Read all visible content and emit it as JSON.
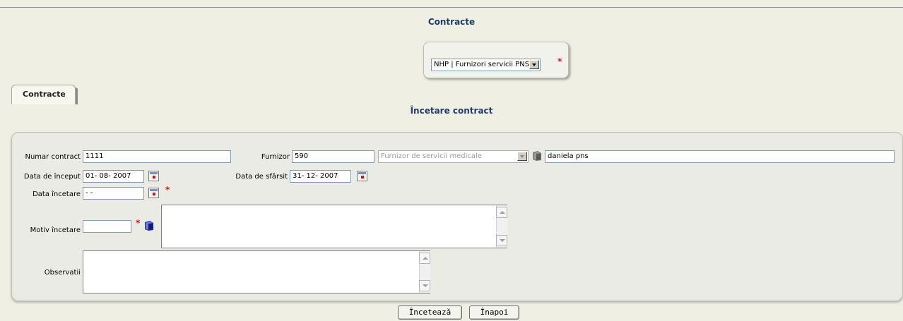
{
  "header": {
    "title": "Contracte"
  },
  "selector": {
    "value": "NHP | Furnizori servicii PNS",
    "required_mark": "*"
  },
  "tabs": [
    {
      "label": "Contracte"
    }
  ],
  "section": {
    "title": "Încetare contract"
  },
  "form": {
    "numar_contract": {
      "label": "Numar contract",
      "value": "1111"
    },
    "furnizor": {
      "label": "Furnizor",
      "code": "590",
      "type": "Furnizor de servicii medicale",
      "name": "daniela pns"
    },
    "data_inceput": {
      "label": "Data de început",
      "value": "01- 08-  2007"
    },
    "data_sfarsit": {
      "label": "Data de sfârsit",
      "value": "31- 12-  2007"
    },
    "data_incetare": {
      "label": "Data încetare",
      "value": "  -   -",
      "required_mark": "*"
    },
    "motiv_incetare": {
      "label": "Motiv încetare",
      "value": "",
      "description": "",
      "required_mark": "*"
    },
    "observatii": {
      "label": "Observatii",
      "value": ""
    }
  },
  "buttons": {
    "inceteaza": "Încetează",
    "inapoi": "Înapoi"
  },
  "colors": {
    "background": "#efefe3",
    "title": "#1f3e6b",
    "required": "#e01010"
  }
}
